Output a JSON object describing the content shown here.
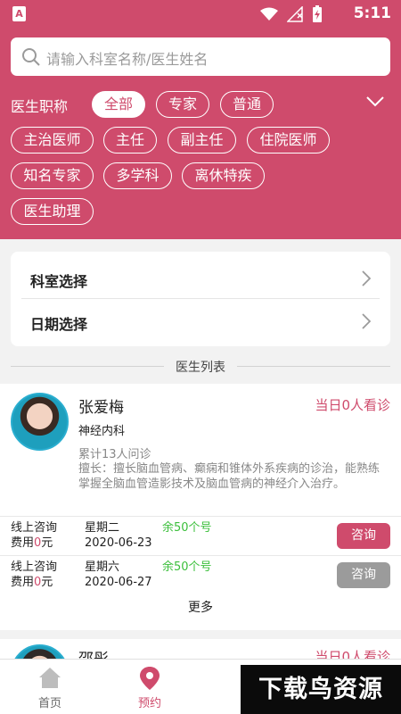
{
  "status_bar": {
    "time": "5:11",
    "app_badge": "A"
  },
  "search": {
    "placeholder": "请输入科室名称/医生姓名"
  },
  "filter": {
    "title": "医生职称",
    "chips": [
      {
        "label": "全部",
        "active": true
      },
      {
        "label": "专家",
        "active": false
      },
      {
        "label": "普通",
        "active": false
      },
      {
        "label": "主治医师",
        "active": false
      },
      {
        "label": "主任",
        "active": false
      },
      {
        "label": "副主任",
        "active": false
      },
      {
        "label": "住院医师",
        "active": false
      },
      {
        "label": "知名专家",
        "active": false
      },
      {
        "label": "多学科",
        "active": false
      },
      {
        "label": "离休特疾",
        "active": false
      },
      {
        "label": "医生助理",
        "active": false
      }
    ]
  },
  "selection": {
    "department": "科室选择",
    "date": "日期选择"
  },
  "list_title": "医生列表",
  "doctors": [
    {
      "name": "张爱梅",
      "status": "当日0人看诊",
      "department": "神经内科",
      "consult_count": "累计13人问诊",
      "skill": "擅长：擅长脑血管病、癫痫和锥体外系疾病的诊治，能熟练掌握全脑血管造影技术及脑血管病的神经介入治疗。",
      "slots": [
        {
          "type": "线上咨询",
          "fee_label": "费用",
          "fee_value": "0",
          "fee_unit": "元",
          "weekday": "星期二",
          "date": "2020-06-23",
          "remaining": "余50个号",
          "button": "咨询",
          "enabled": true
        },
        {
          "type": "线上咨询",
          "fee_label": "费用",
          "fee_value": "0",
          "fee_unit": "元",
          "weekday": "星期六",
          "date": "2020-06-27",
          "remaining": "余50个号",
          "button": "咨询",
          "enabled": false
        }
      ],
      "more": "更多"
    },
    {
      "name": "邵彤",
      "status": "当日0人看诊"
    }
  ],
  "bottom_nav": [
    {
      "label": "首页",
      "icon": "home-icon",
      "active": false
    },
    {
      "label": "预约",
      "icon": "location-pin-icon",
      "active": true
    }
  ],
  "watermark": "下载鸟资源",
  "colors": {
    "accent": "#cf4b6c",
    "available": "#3bbf3b",
    "disabled": "#9b9b9b"
  }
}
